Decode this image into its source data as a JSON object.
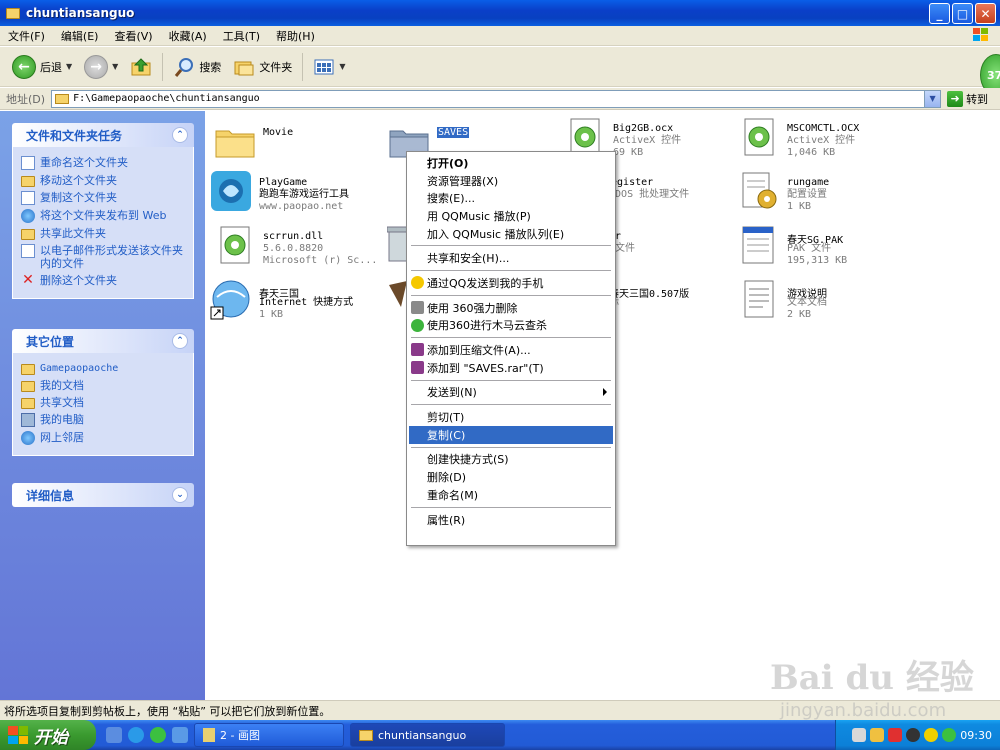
{
  "window": {
    "title": "chuntiansanguo",
    "controls": {
      "minimize": "_",
      "maximize": "□",
      "close": "✕"
    }
  },
  "menubar": {
    "items": [
      "文件(F)",
      "编辑(E)",
      "查看(V)",
      "收藏(A)",
      "工具(T)",
      "帮助(H)"
    ]
  },
  "toolbar": {
    "back": "后退",
    "search": "搜索",
    "folders": "文件夹",
    "side_badge": "37"
  },
  "address": {
    "label": "地址(D)",
    "path": "F:\\Gamepaopaoche\\chuntiansanguo",
    "go": "转到"
  },
  "left_panel": {
    "file_tasks": {
      "title": "文件和文件夹任务",
      "items": [
        "重命名这个文件夹",
        "移动这个文件夹",
        "复制这个文件夹",
        "将这个文件夹发布到 Web",
        "共享此文件夹",
        "以电子邮件形式发送该文件夹内的文件",
        "删除这个文件夹"
      ]
    },
    "other_places": {
      "title": "其它位置",
      "items": [
        "Gamepaopaoche",
        "我的文档",
        "共享文档",
        "我的电脑",
        "网上邻居"
      ]
    },
    "details": {
      "title": "详细信息"
    }
  },
  "files": [
    {
      "name": "Movie",
      "sub1": "",
      "sub2": "",
      "icon": "folder"
    },
    {
      "name": "SAVES",
      "sub1": "",
      "sub2": "",
      "icon": "folder-gray",
      "selected": true
    },
    {
      "name": "Big2GB.ocx",
      "sub1": "ActiveX 控件",
      "sub2": "69 KB",
      "icon": "activex"
    },
    {
      "name": "MSCOMCTL.OCX",
      "sub1": "ActiveX 控件",
      "sub2": "1,046 KB",
      "icon": "activex"
    },
    {
      "name": "PlayGame",
      "sub1": "跑跑车游戏运行工具",
      "sub2": "www.paopao.net",
      "icon": "playgame"
    },
    {
      "name": "register",
      "sub1": "S-DOS 批处理文件",
      "sub2": "KB",
      "icon": "batch"
    },
    {
      "name": "rungame",
      "sub1": "配置设置",
      "sub2": "1 KB",
      "icon": "config"
    },
    {
      "name": "scrrun.dll",
      "sub1": "5.6.0.8820",
      "sub2": "Microsoft (r) Sc...",
      "icon": "dll"
    },
    {
      "name": "ser",
      "sub1": "N 文件",
      "sub2": "KB",
      "icon": "recycle"
    },
    {
      "name": "春天SG.PAK",
      "sub1": "PAK 文件",
      "sub2": "195,313 KB",
      "icon": "pak"
    },
    {
      "name": "春天三国",
      "sub1": "Internet 快捷方式",
      "sub2": "1 KB",
      "icon": "internet"
    },
    {
      "name": "春天三国0.507版",
      "sub1": "标",
      "sub2": "",
      "icon": "game"
    },
    {
      "name": "游戏说明",
      "sub1": "文本文档",
      "sub2": "2 KB",
      "icon": "text"
    }
  ],
  "context_menu": {
    "items": [
      {
        "label": "打开(O)",
        "bold": true
      },
      {
        "label": "资源管理器(X)"
      },
      {
        "label": "搜索(E)..."
      },
      {
        "label": "用 QQMusic 播放(P)"
      },
      {
        "label": "加入 QQMusic 播放队列(E)"
      },
      {
        "sep": true
      },
      {
        "label": "共享和安全(H)..."
      },
      {
        "sep": true
      },
      {
        "label": "通过QQ发送到我的手机",
        "icon": "qq-icon"
      },
      {
        "sep": true
      },
      {
        "label": "使用 360强力删除",
        "icon": "shredder-icon"
      },
      {
        "label": "使用360进行木马云查杀",
        "icon": "360-icon"
      },
      {
        "sep": true
      },
      {
        "label": "添加到压缩文件(A)...",
        "icon": "winrar-icon"
      },
      {
        "label": "添加到 \"SAVES.rar\"(T)",
        "icon": "winrar-icon"
      },
      {
        "sep": true
      },
      {
        "label": "发送到(N)",
        "submenu": true
      },
      {
        "sep": true
      },
      {
        "label": "剪切(T)"
      },
      {
        "label": "复制(C)",
        "highlighted": true
      },
      {
        "sep": true
      },
      {
        "label": "创建快捷方式(S)"
      },
      {
        "label": "删除(D)"
      },
      {
        "label": "重命名(M)"
      },
      {
        "sep": true
      },
      {
        "label": "属性(R)"
      }
    ]
  },
  "statusbar": {
    "text": "将所选项目复制到剪帖板上，使用 “粘贴” 可以把它们放到新位置。"
  },
  "taskbar": {
    "start": "开始",
    "tasks": [
      {
        "label": "2 - 画图",
        "active": false
      },
      {
        "label": "chuntiansanguo",
        "active": true
      }
    ],
    "clock": "09:30"
  },
  "watermark": {
    "line1": "Bai du 经验",
    "line2": "jingyan.baidu.com"
  },
  "colors": {
    "accent": "#316ac5",
    "titlebar": "#0a3fc8",
    "panel": "#7ba2e7",
    "taskbar": "#245edb",
    "start": "#3a9a2f"
  }
}
